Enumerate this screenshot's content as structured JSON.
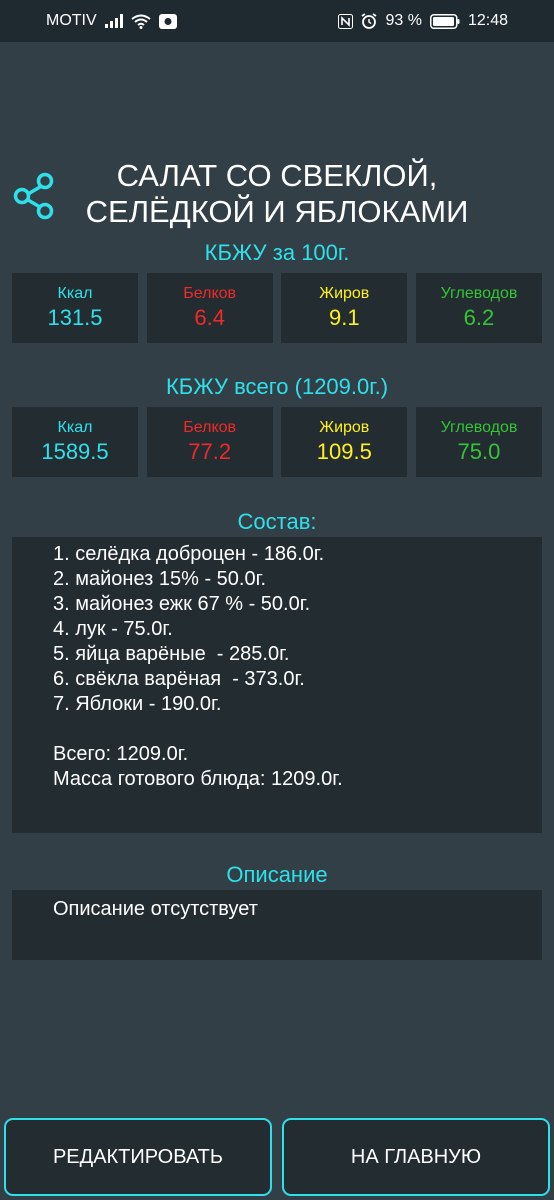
{
  "status_bar": {
    "carrier": "MOTIV",
    "battery": "93 %",
    "time": "12:48"
  },
  "recipe": {
    "title_line1": "САЛАТ СО СВЕКЛОЙ,",
    "title_line2": "СЕЛЁДКОЙ И ЯБЛОКАМИ"
  },
  "kbju_100": {
    "heading": "КБЖУ за 100г.",
    "kcal_label": "Ккал",
    "kcal": "131.5",
    "protein_label": "Белков",
    "protein": "6.4",
    "fat_label": "Жиров",
    "fat": "9.1",
    "carbs_label": "Углеводов",
    "carbs": "6.2"
  },
  "kbju_total": {
    "heading": "КБЖУ всего (1209.0г.)",
    "kcal_label": "Ккал",
    "kcal": "1589.5",
    "protein_label": "Белков",
    "protein": "77.2",
    "fat_label": "Жиров",
    "fat": "109.5",
    "carbs_label": "Углеводов",
    "carbs": "75.0"
  },
  "composition": {
    "heading": "Состав:",
    "items": [
      "1. селёдка доброцен - 186.0г.",
      "2. майонез 15% - 50.0г.",
      "3. майонез ежк 67 % - 50.0г.",
      "4. лук - 75.0г.",
      "5. яйца варёные  - 285.0г.",
      "6. свёкла варёная  - 373.0г.",
      "7. Яблоки - 190.0г."
    ],
    "total": "Всего: 1209.0г.",
    "final_mass": "Масса готового блюда: 1209.0г."
  },
  "description": {
    "heading": "Описание",
    "text": "Описание отсутствует"
  },
  "buttons": {
    "edit": "РЕДАКТИРОВАТЬ",
    "home": "НА ГЛАВНУЮ"
  },
  "colors": {
    "background": "#323f46",
    "panel": "#222c31",
    "accent_cyan": "#2fe0ea",
    "protein_red": "#f02929",
    "fat_yellow": "#fff11e",
    "carbs_green": "#36c336"
  },
  "icons": {
    "share": "share-icon",
    "signal": "signal-icon",
    "wifi": "wifi-icon",
    "nfc": "nfc-icon",
    "alarm": "alarm-icon",
    "battery": "battery-icon"
  }
}
